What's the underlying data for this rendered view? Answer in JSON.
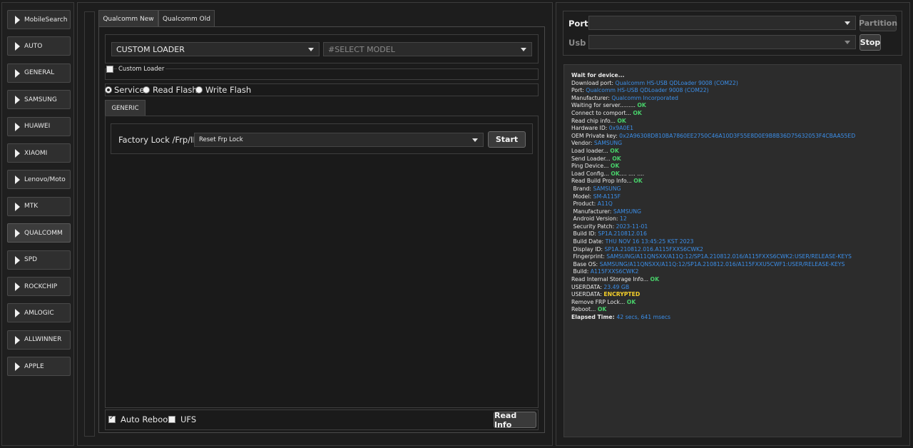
{
  "sidebar": {
    "items": [
      {
        "label": "MobileSearch",
        "active": false
      },
      {
        "label": "AUTO",
        "active": false
      },
      {
        "label": "GENERAL",
        "active": false
      },
      {
        "label": "SAMSUNG",
        "active": false
      },
      {
        "label": "HUAWEI",
        "active": false
      },
      {
        "label": "XIAOMI",
        "active": false
      },
      {
        "label": "Lenovo/Moto",
        "active": false
      },
      {
        "label": "MTK",
        "active": false
      },
      {
        "label": "QUALCOMM",
        "active": true
      },
      {
        "label": "SPD",
        "active": false
      },
      {
        "label": "ROCKCHIP",
        "active": false
      },
      {
        "label": "AMLOGIC",
        "active": false
      },
      {
        "label": "ALLWINNER",
        "active": false
      },
      {
        "label": "APPLE",
        "active": false
      }
    ]
  },
  "tabs": [
    "Qualcomm New",
    "Qualcomm Old"
  ],
  "loader": {
    "loader_value": "CUSTOM LOADER",
    "model_placeholder": "#SELECT MODEL",
    "custom_loader_label": "Custom Loader"
  },
  "modes": {
    "service": "Service",
    "read_flash": "Read Flash",
    "write_flash": "Write Flash",
    "selected": "Service"
  },
  "subtab": "GENERIC",
  "operation": {
    "label": "Factory Lock /Frp/ID",
    "value": "Reset Frp Lock",
    "start": "Start"
  },
  "bottom": {
    "auto_reboot": "Auto Reboot",
    "auto_reboot_checked": true,
    "ufs": "UFS",
    "ufs_checked": false,
    "read_info": "Read Info"
  },
  "port": {
    "port_label": "Port",
    "usb_label": "Usb",
    "partition": "Partition",
    "stop": "Stop"
  },
  "log": [
    [
      {
        "t": "Wait for device...",
        "c": "bold"
      }
    ],
    [
      {
        "t": "Download port: "
      },
      {
        "t": "Qualcomm HS-USB QDLoader 9008 (COM22)",
        "c": "blue"
      }
    ],
    [
      {
        "t": "Port: "
      },
      {
        "t": "Qualcomm HS-USB QDLoader 9008 (COM22)",
        "c": "blue"
      }
    ],
    [
      {
        "t": "Manufacturer: "
      },
      {
        "t": "Qualcomm Incorporated",
        "c": "blue"
      }
    ],
    [
      {
        "t": "Waiting for server......... "
      },
      {
        "t": "OK",
        "c": "green"
      }
    ],
    [
      {
        "t": "Connect to comport... "
      },
      {
        "t": "OK",
        "c": "green"
      }
    ],
    [
      {
        "t": "Read chip info... "
      },
      {
        "t": "OK",
        "c": "green"
      }
    ],
    [
      {
        "t": "Hardware ID: "
      },
      {
        "t": "0x9A0E1",
        "c": "blue"
      }
    ],
    [
      {
        "t": "OEM Private key: "
      },
      {
        "t": "0x2A96308D810BA7860EE2750C46A10D3F55E8D0E9B8B36D75632053F4CBAA55ED",
        "c": "blue"
      }
    ],
    [
      {
        "t": "Vendor: "
      },
      {
        "t": "SAMSUNG",
        "c": "blue"
      }
    ],
    [
      {
        "t": "Load loader... "
      },
      {
        "t": "OK",
        "c": "green"
      }
    ],
    [
      {
        "t": "Send Loader... "
      },
      {
        "t": "OK",
        "c": "green"
      }
    ],
    [
      {
        "t": "Ping Device... "
      },
      {
        "t": "OK",
        "c": "green"
      }
    ],
    [
      {
        "t": "Load Config... "
      },
      {
        "t": "OK",
        "c": "green"
      },
      {
        "t": ".... .... ...."
      }
    ],
    [
      {
        "t": "Read Build Prop Info... "
      },
      {
        "t": "OK",
        "c": "green"
      }
    ],
    [
      {
        "t": " Brand: "
      },
      {
        "t": "SAMSUNG",
        "c": "blue"
      }
    ],
    [
      {
        "t": " Model: "
      },
      {
        "t": "SM-A115F",
        "c": "blue"
      }
    ],
    [
      {
        "t": " Product: "
      },
      {
        "t": "A11Q",
        "c": "blue"
      }
    ],
    [
      {
        "t": " Manufacturer: "
      },
      {
        "t": "SAMSUNG",
        "c": "blue"
      }
    ],
    [
      {
        "t": " Android Version: "
      },
      {
        "t": "12",
        "c": "blue"
      }
    ],
    [
      {
        "t": " Security Patch: "
      },
      {
        "t": "2023-11-01",
        "c": "blue"
      }
    ],
    [
      {
        "t": " Build ID: "
      },
      {
        "t": "SP1A.210812.016",
        "c": "blue"
      }
    ],
    [
      {
        "t": " Build Date: "
      },
      {
        "t": "THU NOV 16 13:45:25 KST 2023",
        "c": "blue"
      }
    ],
    [
      {
        "t": " Display ID: "
      },
      {
        "t": "SP1A.210812.016.A115FXXS6CWK2",
        "c": "blue"
      }
    ],
    [
      {
        "t": " Fingerprint: "
      },
      {
        "t": "SAMSUNG/A11QNSXX/A11Q:12/SP1A.210812.016/A115FXXS6CWK2:USER/RELEASE-KEYS",
        "c": "blue"
      }
    ],
    [
      {
        "t": " Base OS: "
      },
      {
        "t": "SAMSUNG/A11QNSXX/A11Q:12/SP1A.210812.016/A115FXXU5CWF1:USER/RELEASE-KEYS",
        "c": "blue"
      }
    ],
    [
      {
        "t": " Build: "
      },
      {
        "t": "A115FXXS6CWK2",
        "c": "blue"
      }
    ],
    [
      {
        "t": "Read Internal Storage Info... "
      },
      {
        "t": "OK",
        "c": "green"
      }
    ],
    [
      {
        "t": "USERDATA: "
      },
      {
        "t": "23.49 GB",
        "c": "blue"
      }
    ],
    [
      {
        "t": "USERDATA: "
      },
      {
        "t": "ENCRYPTED",
        "c": "yellow"
      }
    ],
    [
      {
        "t": "Remove FRP Lock... "
      },
      {
        "t": "OK",
        "c": "green"
      }
    ],
    [
      {
        "t": "Reboot... "
      },
      {
        "t": "OK",
        "c": "green"
      }
    ],
    [
      {
        "t": "Elapsed Time: ",
        "c": "bold"
      },
      {
        "t": "42 secs, 641 msecs",
        "c": "blue"
      }
    ]
  ]
}
